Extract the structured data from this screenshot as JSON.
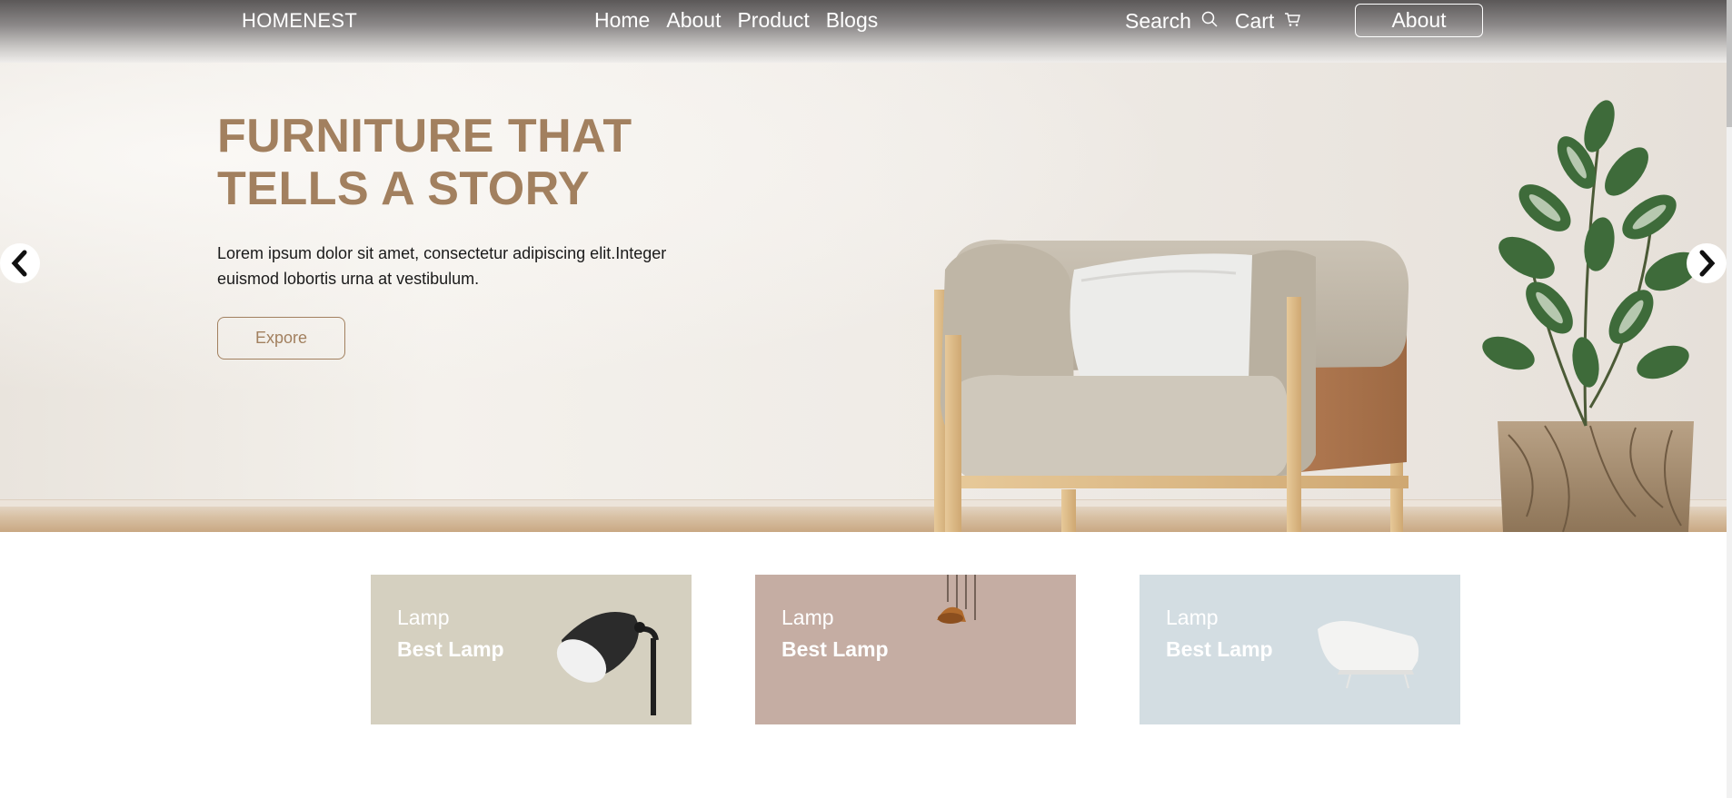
{
  "header": {
    "brand": "HOMENEST",
    "nav": [
      "Home",
      "About",
      "Product",
      "Blogs"
    ],
    "search_label": "Search",
    "cart_label": "Cart",
    "about_button": "About"
  },
  "hero": {
    "title_line1": "FURNITURE THAT",
    "title_line2": "TELLS A STORY",
    "text_line1": "Lorem ipsum dolor sit amet, consectetur adipiscing elit.Integer",
    "text_line2": "euismod lobortis urna at vestibulum.",
    "button": "Expore"
  },
  "cards": [
    {
      "category": "Lamp",
      "name": "Best Lamp",
      "color": "#d5d0c0",
      "icon": "desk-lamp-icon"
    },
    {
      "category": "Lamp",
      "name": "Best Lamp",
      "color": "#c5ada3",
      "icon": "pendant-lamp-icon"
    },
    {
      "category": "Lamp",
      "name": "Best Lamp",
      "color": "#d3dde2",
      "icon": "chair-icon"
    }
  ],
  "colors": {
    "accent": "#a2805f",
    "header_dark": "#5b5858"
  }
}
